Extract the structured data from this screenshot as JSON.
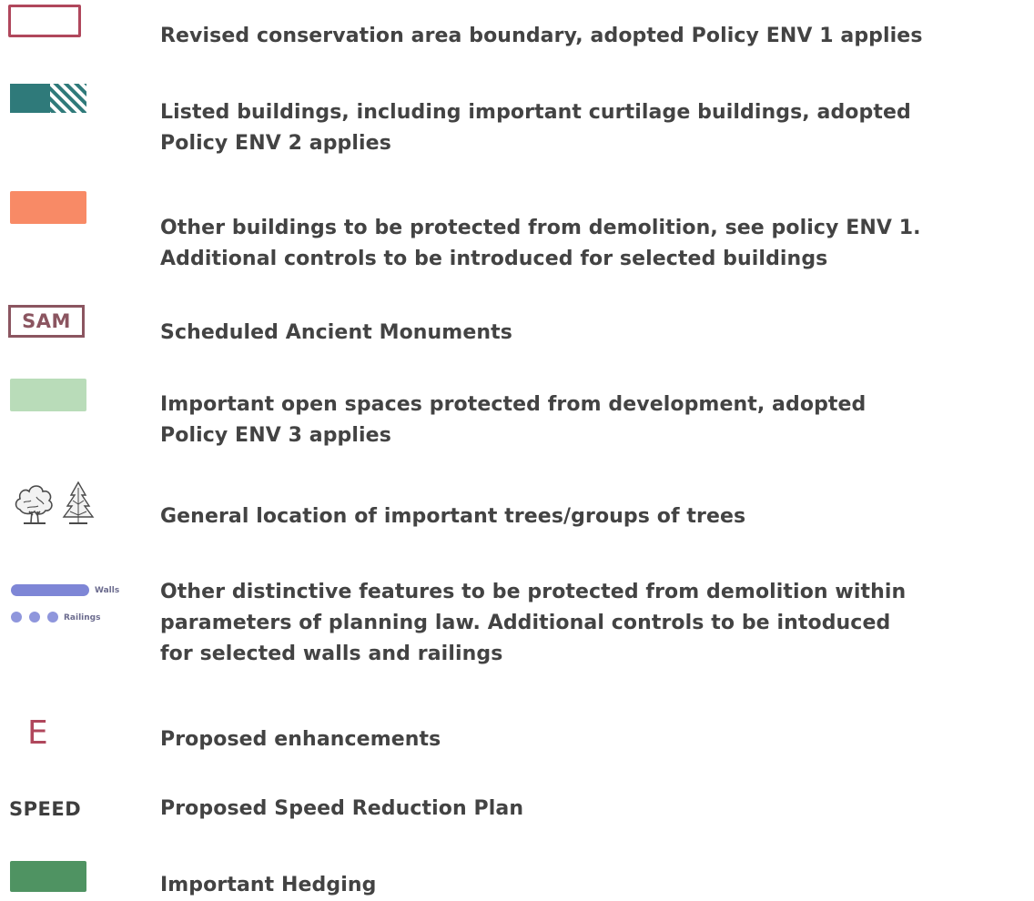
{
  "legend": {
    "items": [
      {
        "symbol": "boundary-outline",
        "text": "Revised conservation area boundary, adopted Policy ENV 1 applies"
      },
      {
        "symbol": "listed-building-swatch",
        "text": "Listed buildings, including important curtilage buildings, adopted\nPolicy ENV 2 applies"
      },
      {
        "symbol": "orange-swatch",
        "text": "Other buildings to be protected from demolition, see policy ENV 1.\nAdditional controls to be introduced for selected buildings"
      },
      {
        "symbol": "sam-label",
        "symbol_text": "SAM",
        "text": "Scheduled Ancient Monuments"
      },
      {
        "symbol": "light-green-swatch",
        "text": "Important open spaces protected from development, adopted\nPolicy ENV 3 applies"
      },
      {
        "symbol": "trees-icon",
        "text": "General location of important trees/groups of trees"
      },
      {
        "symbol": "walls-railings",
        "walls_label": "Walls",
        "railings_label": "Railings",
        "text": "Other distinctive features to be protected from demolition within\nparameters of planning law. Additional controls to be intoduced\nfor selected walls and railings"
      },
      {
        "symbol": "enhancement-letter",
        "symbol_text": "E",
        "text": "Proposed enhancements"
      },
      {
        "symbol": "speed-label",
        "symbol_text": "SPEED",
        "text": "Proposed Speed Reduction Plan"
      },
      {
        "symbol": "dark-green-swatch",
        "text": "Important Hedging"
      }
    ]
  },
  "colors": {
    "boundary": "#b0475c",
    "listed_dark": "#2f7a7a",
    "orange": "#f88a66",
    "sam_border": "#8b5560",
    "light_green": "#b9dcb9",
    "walls_blue": "#7e86d6",
    "enhancement": "#b0475c",
    "hedging": "#4f9362"
  }
}
